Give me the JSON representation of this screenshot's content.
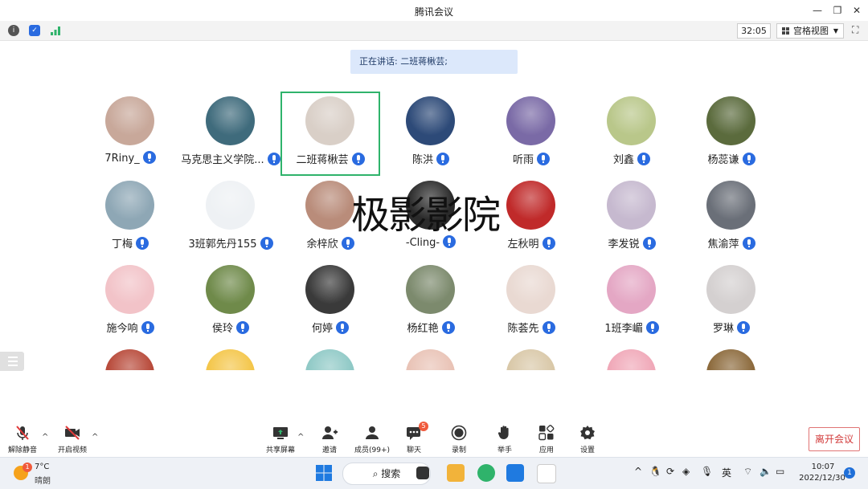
{
  "window": {
    "title": "腾讯会议"
  },
  "toolbar": {
    "timer": "32:05",
    "view_label": "宫格视图"
  },
  "speaking": {
    "text": "正在讲话: 二班蒋楸芸;"
  },
  "participants": [
    {
      "name": "7Riny_",
      "color": "#c8a89a"
    },
    {
      "name": "马克思主义学院...",
      "color": "#3f6b7c"
    },
    {
      "name": "二班蒋楸芸",
      "color": "#d9cfc7"
    },
    {
      "name": "陈洪",
      "color": "#2d4a78"
    },
    {
      "name": "听雨",
      "color": "#7a6aa6"
    },
    {
      "name": "刘鑫",
      "color": "#b9c78a"
    },
    {
      "name": "杨蕊谦",
      "color": "#5b6b3d"
    },
    {
      "name": "丁梅",
      "color": "#8ea7b5"
    },
    {
      "name": "3班郭先丹155",
      "color": "#eef1f4"
    },
    {
      "name": "余梓欣",
      "color": "#b98c7a"
    },
    {
      "name": "-Cling-",
      "color": "#2a2a2a"
    },
    {
      "name": "左秋明",
      "color": "#c02a2a"
    },
    {
      "name": "李发锐",
      "color": "#c6b9cf"
    },
    {
      "name": "焦渝萍",
      "color": "#6a6f78"
    },
    {
      "name": "施今响",
      "color": "#f2c3c8"
    },
    {
      "name": "侯玲",
      "color": "#6f8a4a"
    },
    {
      "name": "何婷",
      "color": "#3a3a3a"
    },
    {
      "name": "杨红艳",
      "color": "#7c8a6d"
    },
    {
      "name": "陈荟先",
      "color": "#e9d9d2"
    },
    {
      "name": "1班李嵋",
      "color": "#e4a7c4"
    },
    {
      "name": "罗琳",
      "color": "#d4d0d0"
    },
    {
      "name": "",
      "color": "#b84a3a"
    },
    {
      "name": "",
      "color": "#f4c64a"
    },
    {
      "name": "",
      "color": "#8fc9c6"
    },
    {
      "name": "",
      "color": "#e9c3b6"
    },
    {
      "name": "",
      "color": "#d9c8a8"
    },
    {
      "name": "",
      "color": "#f0a8b8"
    },
    {
      "name": "",
      "color": "#8c6a3c"
    }
  ],
  "watermark": "极影影院",
  "bottom_bar": {
    "unmute": "解除静音",
    "start_video": "开启视频",
    "share_screen": "共享屏幕",
    "invite": "邀请",
    "members": "成员(99+)",
    "chat": "聊天",
    "chat_badge": "5",
    "record": "录制",
    "raise_hand": "举手",
    "apps": "应用",
    "settings": "设置",
    "leave": "离开会议"
  },
  "taskbar": {
    "weather_temp": "7°C",
    "weather_desc": "晴朗",
    "weather_badge": "1",
    "search": "搜索",
    "ime": "英",
    "time": "10:07",
    "date": "2022/12/30",
    "notif_count": "1"
  }
}
